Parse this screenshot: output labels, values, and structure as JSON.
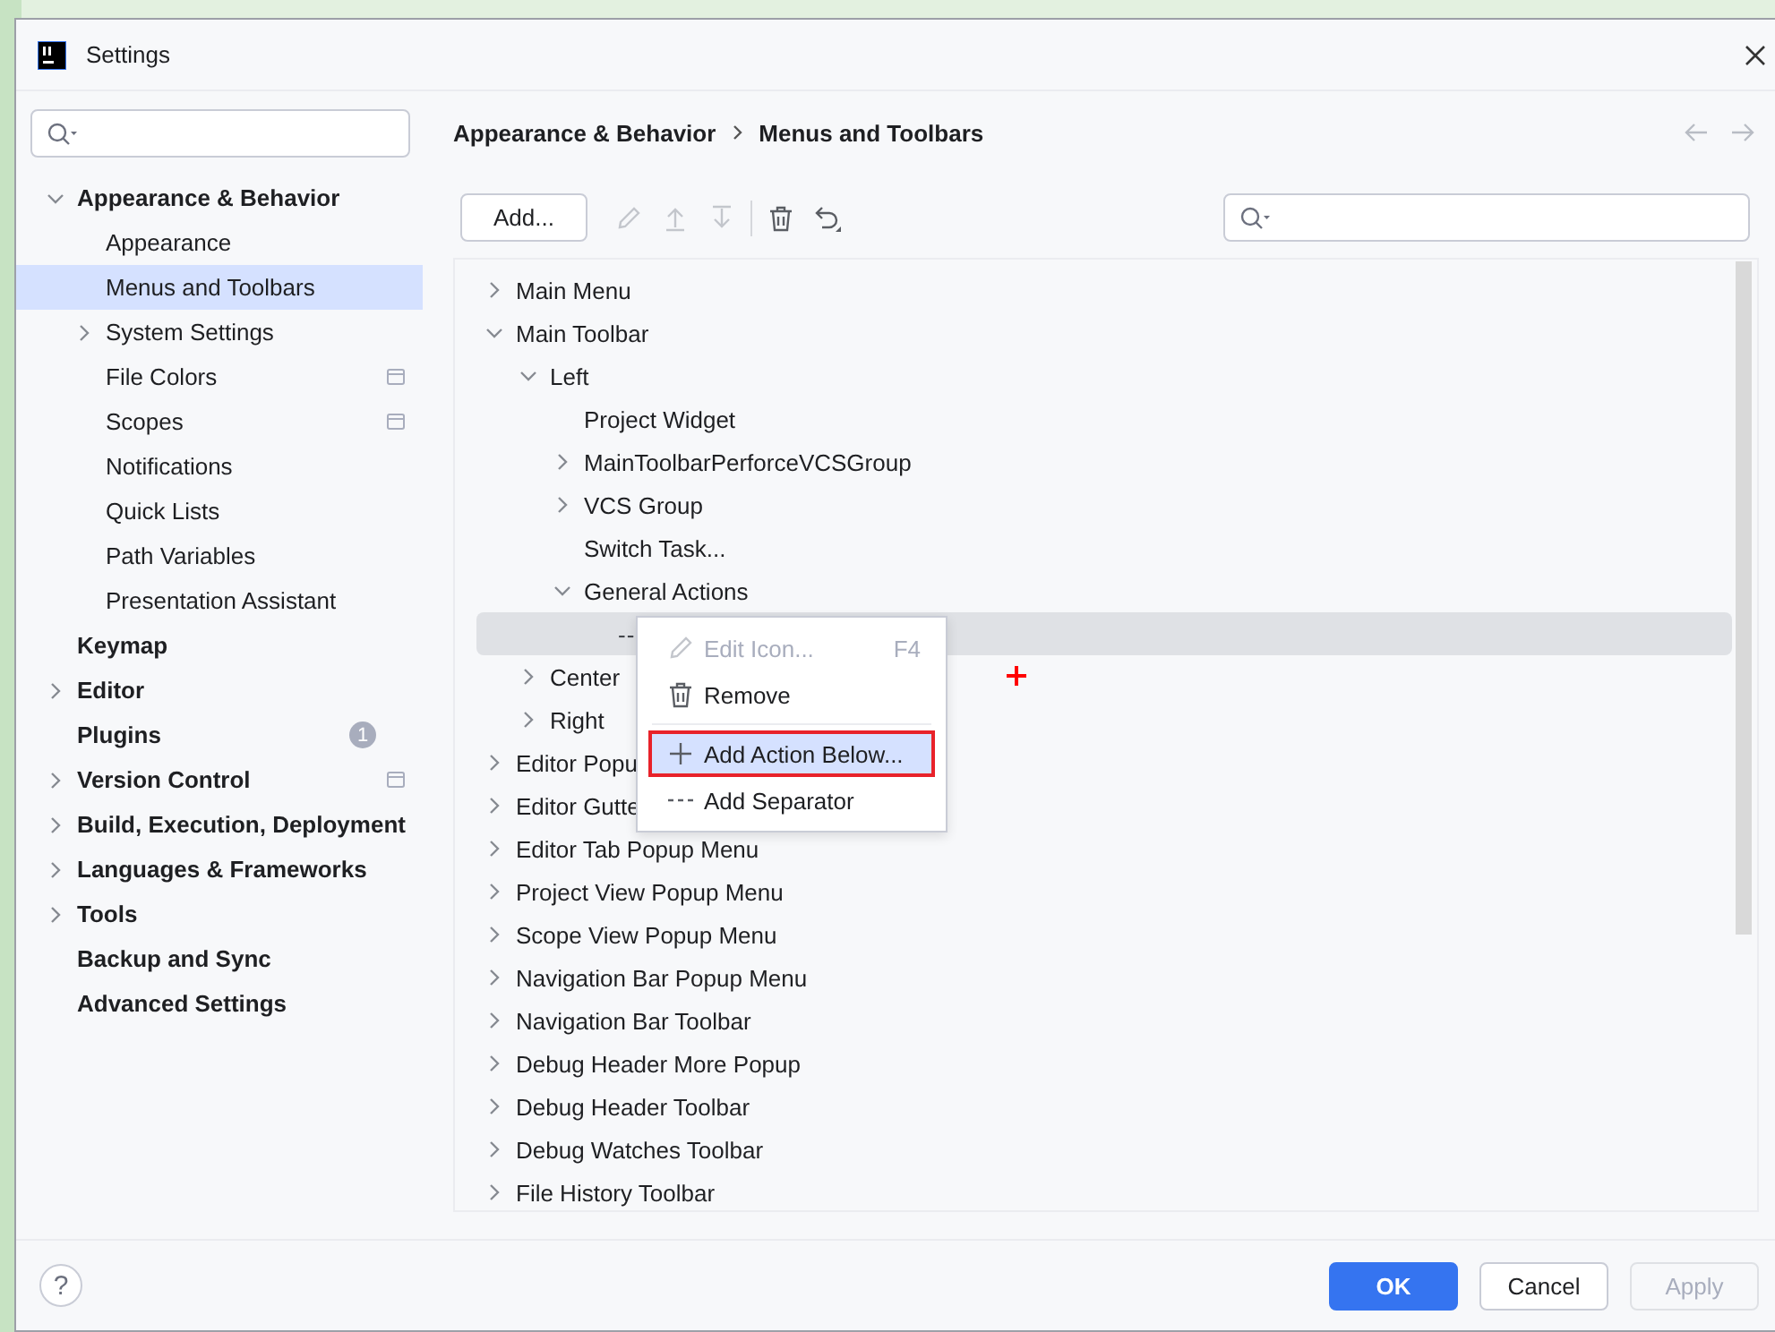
{
  "window": {
    "title": "Settings"
  },
  "sidebar": {
    "items": [
      {
        "label": "Appearance & Behavior",
        "expanded": true,
        "selected": false,
        "children": [
          {
            "label": "Appearance",
            "selected": false
          },
          {
            "label": "Menus and Toolbars",
            "selected": true
          },
          {
            "label": "System Settings",
            "expanded": false,
            "selected": false
          },
          {
            "label": "File Colors",
            "selected": false,
            "project_level": true
          },
          {
            "label": "Scopes",
            "selected": false,
            "project_level": true
          },
          {
            "label": "Notifications",
            "selected": false
          },
          {
            "label": "Quick Lists",
            "selected": false
          },
          {
            "label": "Path Variables",
            "selected": false
          },
          {
            "label": "Presentation Assistant",
            "selected": false
          }
        ]
      },
      {
        "label": "Keymap",
        "selected": false
      },
      {
        "label": "Editor",
        "expanded": false,
        "selected": false
      },
      {
        "label": "Plugins",
        "selected": false,
        "badge": "1"
      },
      {
        "label": "Version Control",
        "expanded": false,
        "selected": false,
        "project_level": true
      },
      {
        "label": "Build, Execution, Deployment",
        "expanded": false,
        "selected": false
      },
      {
        "label": "Languages & Frameworks",
        "expanded": false,
        "selected": false
      },
      {
        "label": "Tools",
        "expanded": false,
        "selected": false
      },
      {
        "label": "Backup and Sync",
        "selected": false
      },
      {
        "label": "Advanced Settings",
        "selected": false
      }
    ]
  },
  "breadcrumb": [
    "Appearance & Behavior",
    "Menus and Toolbars"
  ],
  "toolbar": {
    "add_button": "Add...",
    "tools": [
      {
        "kind": "edit",
        "disabled": true
      },
      {
        "kind": "move-up",
        "disabled": true
      },
      {
        "kind": "move-down",
        "disabled": true
      },
      {
        "kind": "divider"
      },
      {
        "kind": "remove",
        "disabled": false
      },
      {
        "kind": "restore",
        "disabled": false
      }
    ]
  },
  "tree": [
    {
      "label": "Main Menu",
      "expanded": false,
      "selected": false
    },
    {
      "label": "Main Toolbar",
      "expanded": true,
      "selected": false,
      "children": [
        {
          "label": "Left",
          "expanded": true,
          "selected": false,
          "children": [
            {
              "label": "Project Widget",
              "selected": false
            },
            {
              "label": "MainToolbarPerforceVCSGroup",
              "expanded": false,
              "selected": false
            },
            {
              "label": "VCS Group",
              "expanded": false,
              "selected": false
            },
            {
              "label": "Switch Task...",
              "selected": false
            },
            {
              "label": "General Actions",
              "expanded": true,
              "selected": false,
              "children": [
                {
                  "label": "--",
                  "kind": "separator",
                  "selected": true
                }
              ]
            }
          ]
        },
        {
          "label": "Center",
          "expanded": false,
          "selected": false
        },
        {
          "label": "Right",
          "expanded": false,
          "selected": false
        }
      ]
    },
    {
      "label": "Editor Popu",
      "expanded": false,
      "selected": false
    },
    {
      "label": "Editor Gutte",
      "expanded": false,
      "selected": false
    },
    {
      "label": "Editor Tab Popup Menu",
      "expanded": false,
      "selected": false
    },
    {
      "label": "Project View Popup Menu",
      "expanded": false,
      "selected": false
    },
    {
      "label": "Scope View Popup Menu",
      "expanded": false,
      "selected": false
    },
    {
      "label": "Navigation Bar Popup Menu",
      "expanded": false,
      "selected": false
    },
    {
      "label": "Navigation Bar Toolbar",
      "expanded": false,
      "selected": false
    },
    {
      "label": "Debug Header More Popup",
      "expanded": false,
      "selected": false
    },
    {
      "label": "Debug Header Toolbar",
      "expanded": false,
      "selected": false
    },
    {
      "label": "Debug Watches Toolbar",
      "expanded": false,
      "selected": false
    },
    {
      "label": "File History Toolbar",
      "expanded": false,
      "selected": false
    }
  ],
  "context_menu": [
    {
      "kind": "edit",
      "label": "Edit Icon...",
      "shortcut": "F4",
      "disabled": true,
      "highlighted": false
    },
    {
      "kind": "remove",
      "label": "Remove",
      "disabled": false,
      "highlighted": false
    },
    {
      "kind": "separator"
    },
    {
      "kind": "add",
      "label": "Add Action Below...",
      "disabled": false,
      "highlighted": true,
      "outlined": true
    },
    {
      "kind": "add-separator",
      "label": "Add Separator",
      "disabled": false,
      "highlighted": false
    }
  ],
  "footer": {
    "help": "?",
    "buttons": [
      {
        "label": "OK",
        "kind": "primary",
        "disabled": false
      },
      {
        "label": "Cancel",
        "kind": "secondary",
        "disabled": false
      },
      {
        "label": "Apply",
        "kind": "secondary",
        "disabled": true
      }
    ]
  }
}
